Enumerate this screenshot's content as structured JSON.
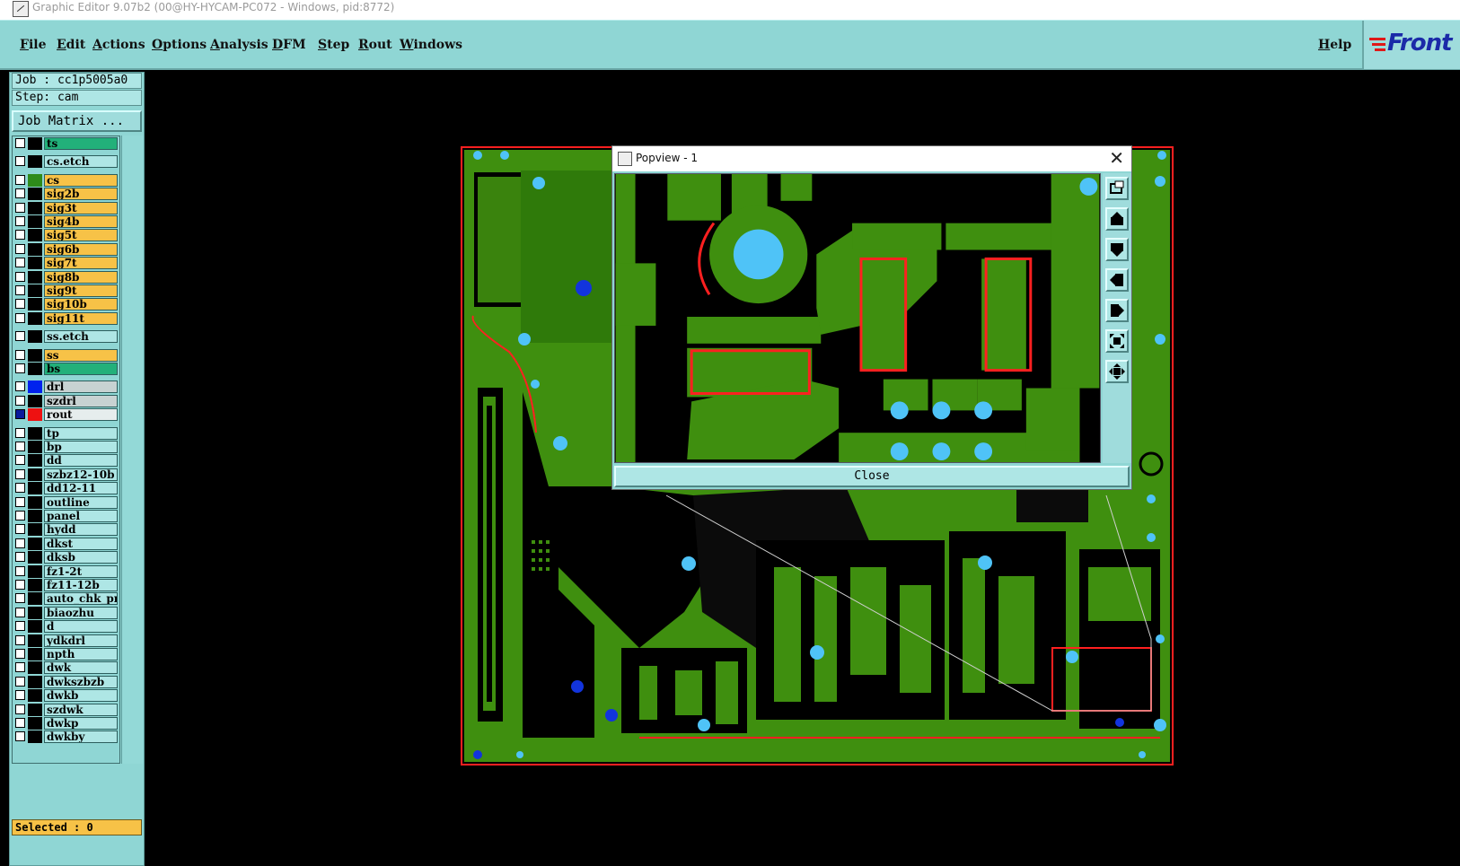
{
  "window": {
    "title": "Graphic Editor 9.07b2 (00@HY-HYCAM-PC072 - Windows, pid:8772)"
  },
  "menu": {
    "items": [
      "File",
      "Edit",
      "Actions",
      "Options",
      "Analysis",
      "DFM",
      "Step",
      "Rout",
      "Windows"
    ],
    "help": "Help"
  },
  "logo": {
    "text": "Front"
  },
  "panel": {
    "job": "Job : cc1p5005a0",
    "step": "Step: cam",
    "job_matrix": "Job Matrix ...",
    "selected": "Selected : 0"
  },
  "layers": [
    {
      "name": "ts",
      "type": "green",
      "color": "#000000",
      "checked": false
    },
    {
      "name": "cs.etch",
      "type": "cyan",
      "color": "#000000",
      "checked": false
    },
    {
      "name": "cs",
      "type": "orange",
      "color": "#2e8b1a",
      "checked": false
    },
    {
      "name": "sig2b",
      "type": "orange",
      "color": "#000000",
      "checked": false
    },
    {
      "name": "sig3t",
      "type": "orange",
      "color": "#000000",
      "checked": false
    },
    {
      "name": "sig4b",
      "type": "orange",
      "color": "#000000",
      "checked": false
    },
    {
      "name": "sig5t",
      "type": "orange",
      "color": "#000000",
      "checked": false
    },
    {
      "name": "sig6b",
      "type": "orange",
      "color": "#000000",
      "checked": false
    },
    {
      "name": "sig7t",
      "type": "orange",
      "color": "#000000",
      "checked": false
    },
    {
      "name": "sig8b",
      "type": "orange",
      "color": "#000000",
      "checked": false
    },
    {
      "name": "sig9t",
      "type": "orange",
      "color": "#000000",
      "checked": false
    },
    {
      "name": "sig10b",
      "type": "orange",
      "color": "#000000",
      "checked": false
    },
    {
      "name": "sig11t",
      "type": "orange",
      "color": "#000000",
      "checked": false
    },
    {
      "name": "ss.etch",
      "type": "cyan",
      "color": "#000000",
      "checked": false
    },
    {
      "name": "ss",
      "type": "orange",
      "color": "#000000",
      "checked": false
    },
    {
      "name": "bs",
      "type": "green",
      "color": "#000000",
      "checked": false
    },
    {
      "name": "drl",
      "type": "gray",
      "color": "#0022ee",
      "checked": false
    },
    {
      "name": "szdrl",
      "type": "gray",
      "color": "#000000",
      "checked": false
    },
    {
      "name": "rout",
      "type": "white",
      "color": "#ee1111",
      "checked": true
    },
    {
      "name": "tp",
      "type": "cyan",
      "color": "#000000",
      "checked": false
    },
    {
      "name": "bp",
      "type": "cyan",
      "color": "#000000",
      "checked": false
    },
    {
      "name": "dd",
      "type": "cyan",
      "color": "#000000",
      "checked": false
    },
    {
      "name": "szbz12-10b",
      "type": "cyan",
      "color": "#000000",
      "checked": false
    },
    {
      "name": "dd12-11",
      "type": "cyan",
      "color": "#000000",
      "checked": false
    },
    {
      "name": "outline",
      "type": "cyan",
      "color": "#000000",
      "checked": false
    },
    {
      "name": "panel",
      "type": "cyan",
      "color": "#000000",
      "checked": false
    },
    {
      "name": "hydd",
      "type": "cyan",
      "color": "#000000",
      "checked": false
    },
    {
      "name": "dkst",
      "type": "cyan",
      "color": "#000000",
      "checked": false
    },
    {
      "name": "dksb",
      "type": "cyan",
      "color": "#000000",
      "checked": false
    },
    {
      "name": "fz1-2t",
      "type": "cyan",
      "color": "#000000",
      "checked": false
    },
    {
      "name": "fz11-12b",
      "type": "cyan",
      "color": "#000000",
      "checked": false
    },
    {
      "name": "auto_chk_pn",
      "type": "cyan",
      "color": "#000000",
      "checked": false
    },
    {
      "name": "biaozhu",
      "type": "cyan",
      "color": "#000000",
      "checked": false
    },
    {
      "name": "d",
      "type": "cyan",
      "color": "#000000",
      "checked": false
    },
    {
      "name": "ydkdrl",
      "type": "cyan",
      "color": "#000000",
      "checked": false
    },
    {
      "name": "npth",
      "type": "cyan",
      "color": "#000000",
      "checked": false
    },
    {
      "name": "dwk",
      "type": "cyan",
      "color": "#000000",
      "checked": false
    },
    {
      "name": "dwkszbzb",
      "type": "cyan",
      "color": "#000000",
      "checked": false
    },
    {
      "name": "dwkb",
      "type": "cyan",
      "color": "#000000",
      "checked": false
    },
    {
      "name": "szdwk",
      "type": "cyan",
      "color": "#000000",
      "checked": false
    },
    {
      "name": "dwkp",
      "type": "cyan",
      "color": "#000000",
      "checked": false
    },
    {
      "name": "dwkby",
      "type": "cyan",
      "color": "#000000",
      "checked": false
    }
  ],
  "colors": {
    "board_green": "#3f8f0f",
    "trace_red": "#ff2020",
    "pad_cyan": "#4fc3f7",
    "drill_blue": "#1234dd",
    "menu_bg": "#8fd6d4",
    "layer_orange": "#f7c247",
    "layer_green": "#22b07a",
    "layer_cyan": "#aee6e5",
    "layer_gray": "#c7d2d2"
  },
  "popview": {
    "title": "Popview - 1",
    "close_label": "Close",
    "tools": [
      "zoom-fit-icon",
      "pan-up-icon",
      "pan-down-icon",
      "pan-left-icon",
      "pan-right-icon",
      "zoom-out-icon",
      "zoom-in-icon"
    ]
  }
}
